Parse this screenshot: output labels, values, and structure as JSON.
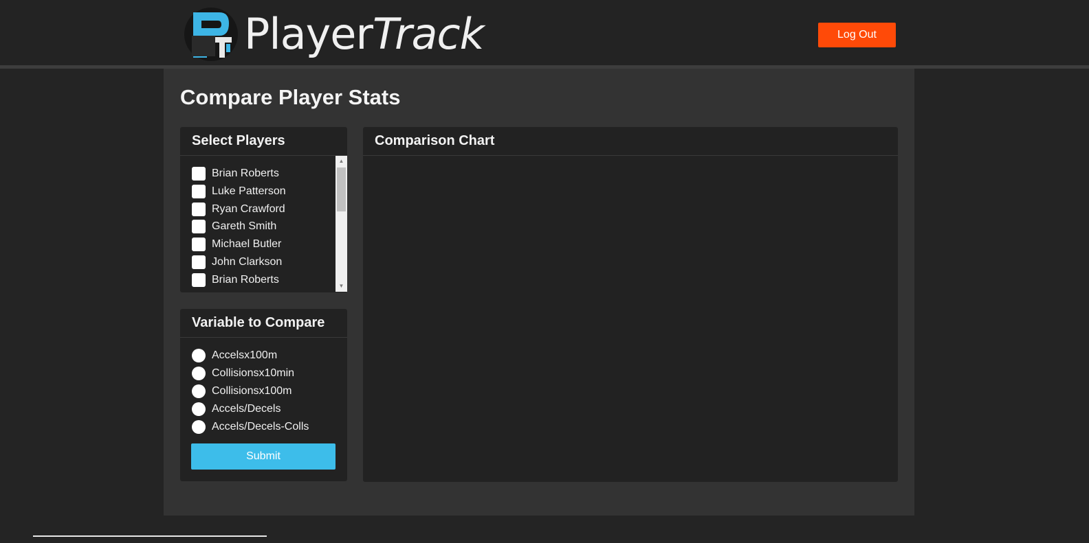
{
  "header": {
    "brand": {
      "part1": "Player",
      "part2": "Track",
      "logo_icon": "playertrack-logo-icon"
    },
    "logout_label": "Log Out"
  },
  "page": {
    "title": "Compare Player Stats"
  },
  "players_panel": {
    "title": "Select Players",
    "players": [
      {
        "name": "Brian Roberts",
        "checked": false
      },
      {
        "name": "Luke Patterson",
        "checked": false
      },
      {
        "name": "Ryan Crawford",
        "checked": false
      },
      {
        "name": "Gareth Smith",
        "checked": false
      },
      {
        "name": "Michael Butler",
        "checked": false
      },
      {
        "name": "John Clarkson",
        "checked": false
      },
      {
        "name": "Brian Roberts",
        "checked": false
      }
    ],
    "scroll_up_icon": "triangle-up-icon",
    "scroll_down_icon": "triangle-down-icon"
  },
  "variable_panel": {
    "title": "Variable to Compare",
    "options": [
      {
        "label": "Accelsx100m",
        "selected": false
      },
      {
        "label": "Collisionsx10min",
        "selected": false
      },
      {
        "label": "Collisionsx100m",
        "selected": false
      },
      {
        "label": "Accels/Decels",
        "selected": false
      },
      {
        "label": "Accels/Decels-Colls",
        "selected": false
      }
    ],
    "submit_label": "Submit"
  },
  "chart_panel": {
    "title": "Comparison Chart"
  },
  "colors": {
    "logout": "#ff4a08",
    "submit": "#3dbdea",
    "logo_blue": "#3db5e6"
  }
}
